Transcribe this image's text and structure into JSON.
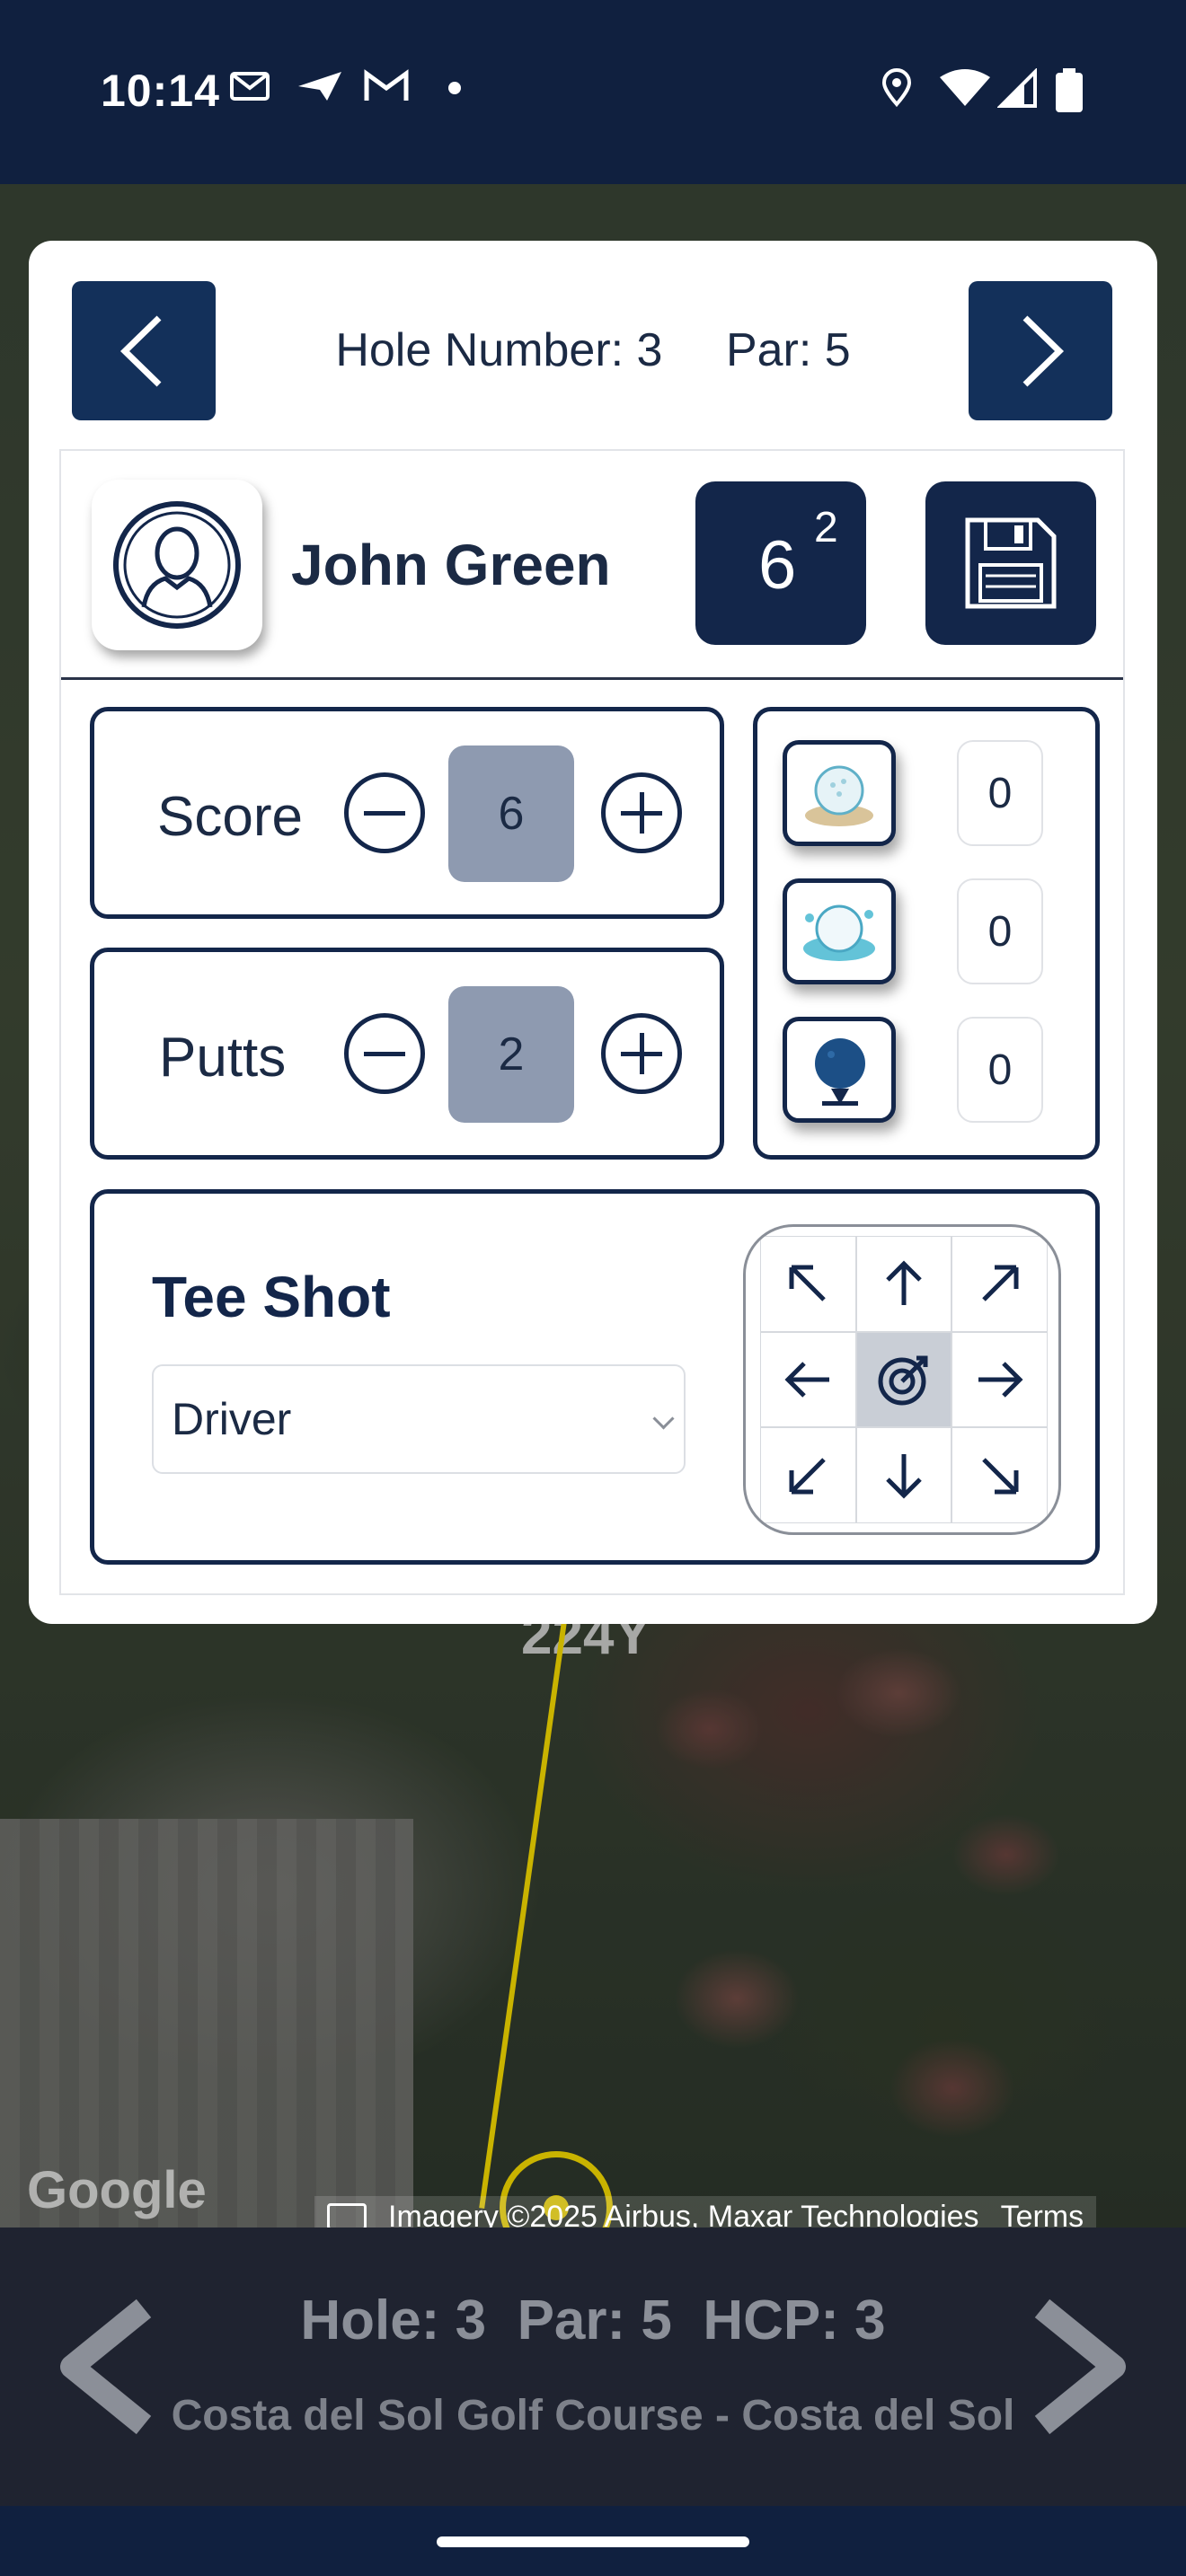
{
  "status_bar": {
    "time": "10:14",
    "left_icons": [
      "mail-icon",
      "send-icon",
      "gmail-icon",
      "dot-icon"
    ],
    "right_icons": [
      "location-icon",
      "wifi-icon",
      "signal-icon",
      "battery-icon"
    ]
  },
  "modal": {
    "prev_icon": "chevron-left-icon",
    "next_icon": "chevron-right-icon",
    "hole_label": "Hole Number: 3",
    "par_label": "Par: 5",
    "player": {
      "name": "John Green",
      "avatar_icon": "person-sketch-icon",
      "score": "6",
      "putts": "2",
      "save_icon": "floppy-disk-icon"
    },
    "counters": [
      {
        "label": "Score",
        "value": "6"
      },
      {
        "label": "Putts",
        "value": "2"
      }
    ],
    "stats": [
      {
        "icon": "golf-ball-sand-icon",
        "value": "0"
      },
      {
        "icon": "golf-ball-water-icon",
        "value": "0"
      },
      {
        "icon": "golf-ball-tee-icon",
        "value": "0"
      }
    ],
    "tee_shot": {
      "title": "Tee Shot",
      "club": "Driver",
      "directions": [
        "arrow-up-left-icon",
        "arrow-up-icon",
        "arrow-up-right-icon",
        "arrow-left-icon",
        "target-icon",
        "arrow-right-icon",
        "arrow-down-left-icon",
        "arrow-down-icon",
        "arrow-down-right-icon"
      ],
      "selected": "target-icon"
    }
  },
  "map": {
    "distance_label": "224Y",
    "google_logo": "Google",
    "attribution": "Imagery ©2025 Airbus, Maxar Technologies",
    "terms": "Terms"
  },
  "bottom_bar": {
    "hole_info": "Hole: 3  Par: 5  HCP: 3",
    "course": "Costa del Sol Golf Course - Costa del Sol"
  },
  "colors": {
    "navy": "#13264a",
    "value_box": "#8e9ab0",
    "status_bar": "#10203f",
    "map_line": "#c9b300"
  }
}
